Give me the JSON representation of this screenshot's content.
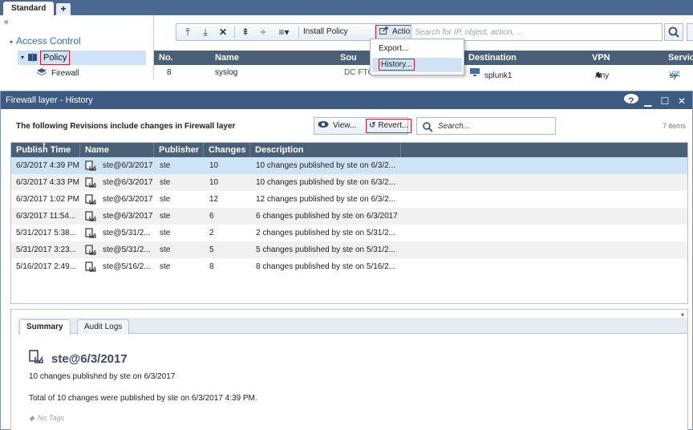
{
  "tabs": {
    "standard": "Standard",
    "add": "+"
  },
  "leftnav": {
    "collapse": "«",
    "access_control": "Access Control",
    "policy": "Policy",
    "firewall": "Firewall"
  },
  "toolbar": {
    "install_policy": "Install Policy",
    "actions": "Actions",
    "search_placeholder": "Search for IP, object, action, ..."
  },
  "actions_menu": {
    "items": [
      "Export...",
      "History..."
    ]
  },
  "policy_grid": {
    "columns": [
      "No.",
      "Name",
      "Sou",
      "Destination",
      "VPN",
      "Servic"
    ],
    "row": {
      "no": "8",
      "name": "syslog",
      "source": "DC FTC",
      "destination": "splunk1",
      "vpn": "Any",
      "service_badge": "UDP",
      "service": "sy"
    }
  },
  "dialog": {
    "title": "Firewall layer - History",
    "caption": "The following Revisions include changes in Firewall layer",
    "view_label": "View...",
    "revert_label": "Revert...",
    "search_placeholder": "Search...",
    "items_count": "7 items",
    "columns": [
      "Publish Time",
      "Name",
      "Publisher",
      "Changes",
      "Description"
    ],
    "rows": [
      {
        "time": "6/3/2017 4:39 PM",
        "name": "ste@6/3/2017",
        "publisher": "ste",
        "changes": "10",
        "desc": "10 changes published by ste on 6/3/2..."
      },
      {
        "time": "6/3/2017 4:33 PM",
        "name": "ste@6/3/2017",
        "publisher": "ste",
        "changes": "10",
        "desc": "10 changes published by ste on 6/3/2..."
      },
      {
        "time": "6/3/2017 1:02 PM",
        "name": "ste@6/3/2017",
        "publisher": "ste",
        "changes": "12",
        "desc": "12 changes published by ste on 6/3/2..."
      },
      {
        "time": "6/3/2017 11:54...",
        "name": "ste@6/3/2017",
        "publisher": "ste",
        "changes": "6",
        "desc": "6 changes published by ste on 6/3/2017"
      },
      {
        "time": "5/31/2017 5:38...",
        "name": "ste@5/31/2...",
        "publisher": "ste",
        "changes": "2",
        "desc": "2 changes published by ste on 5/31/2..."
      },
      {
        "time": "5/31/2017 3:23...",
        "name": "ste@5/31/2...",
        "publisher": "ste",
        "changes": "5",
        "desc": "5 changes published by ste on 5/31/2..."
      },
      {
        "time": "5/16/2017 2:49...",
        "name": "ste@5/16/2...",
        "publisher": "ste",
        "changes": "8",
        "desc": "8 changes published by ste on 5/16/2..."
      }
    ],
    "summary_tab": "Summary",
    "audit_tab": "Audit Logs",
    "summary": {
      "title": "ste@6/3/2017",
      "line1": "10 changes published by ste on 6/3/2017",
      "line2": "Total of 10 changes were published by ste on 6/3/2017 4:39 PM.",
      "tags": "No Tags"
    }
  }
}
